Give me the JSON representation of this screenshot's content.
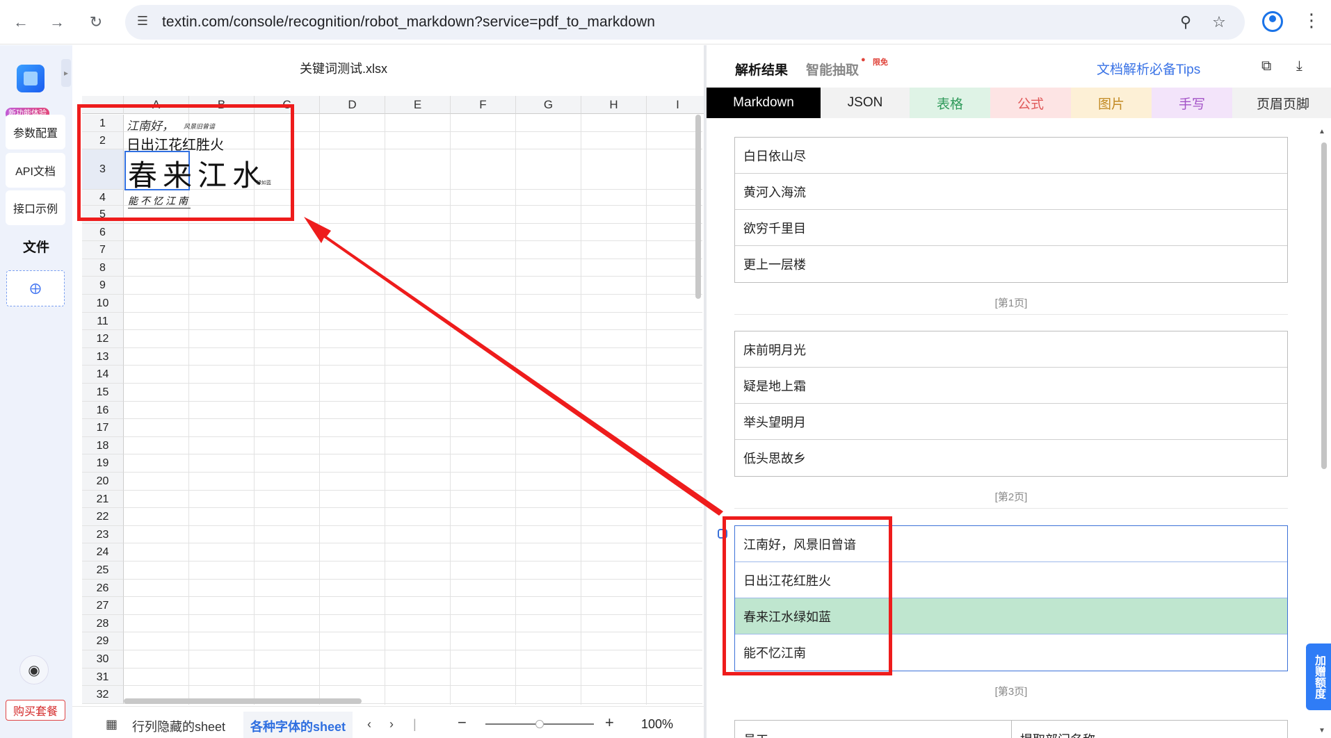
{
  "browser": {
    "url": "textin.com/console/recognition/robot_markdown?service=pdf_to_markdown",
    "back_icon": "arrow-left",
    "forward_icon": "arrow-right",
    "reload_icon": "reload"
  },
  "sidebar": {
    "new_badge": "新功能体验",
    "items": [
      {
        "label": "参数配置"
      },
      {
        "label": "API文档"
      },
      {
        "label": "接口示例"
      }
    ],
    "files_title": "文件",
    "buy_label": "购买套餐"
  },
  "sheet": {
    "file_name": "关键词测试.xlsx",
    "columns": [
      "A",
      "B",
      "C",
      "D",
      "E",
      "F",
      "G",
      "H",
      "I"
    ],
    "rows": [
      "1",
      "2",
      "3",
      "4",
      "5",
      "6",
      "7",
      "8",
      "9",
      "10",
      "11",
      "12",
      "13",
      "14",
      "15",
      "16",
      "17",
      "18",
      "19",
      "20",
      "21",
      "22",
      "23",
      "24",
      "25",
      "26",
      "27",
      "28",
      "29",
      "30",
      "31",
      "32"
    ],
    "cells": {
      "a1": "江南好，",
      "a1_small": "风景旧曾谙",
      "a2": "日出江花红胜火",
      "a3_big": "春来江水",
      "a3_small": "绿如蓝",
      "a4": "能不忆江南"
    },
    "tabs": [
      {
        "label": "行列隐藏的sheet"
      },
      {
        "label": "各种字体的sheet"
      }
    ],
    "zoom": "100%"
  },
  "panel": {
    "tab_result": "解析结果",
    "tab_extract": "智能抽取",
    "free_badge": "限免",
    "tips": "文档解析必备Tips",
    "format_tabs": [
      {
        "label": "Markdown",
        "bg": "#000000",
        "fg": "#ffffff"
      },
      {
        "label": "JSON",
        "bg": "#f2f2f2",
        "fg": "#222222"
      },
      {
        "label": "表格",
        "bg": "#dff3e6",
        "fg": "#2f9a5a"
      },
      {
        "label": "公式",
        "bg": "#fde4e4",
        "fg": "#e05a5a"
      },
      {
        "label": "图片",
        "bg": "#fdf0d6",
        "fg": "#c28a23"
      },
      {
        "label": "手写",
        "bg": "#f3e4fa",
        "fg": "#a352c7"
      },
      {
        "label": "页眉页脚",
        "bg": "#f2f2f2",
        "fg": "#333333"
      }
    ],
    "pages": [
      {
        "rows": [
          "白日依山尽",
          "黄河入海流",
          "欲穷千里目",
          "更上一层楼"
        ],
        "label": "[第1页]"
      },
      {
        "rows": [
          "床前明月光",
          "疑是地上霜",
          "举头望明月",
          "低头思故乡"
        ],
        "label": "[第2页]"
      },
      {
        "rows": [
          "江南好，风景旧曾谙",
          "日出江花红胜火",
          "春来江水绿如蓝",
          "能不忆江南"
        ],
        "label": "[第3页]"
      }
    ],
    "next_table": [
      "员工",
      "提取部门名称"
    ],
    "add_quota": "加赠额度"
  }
}
